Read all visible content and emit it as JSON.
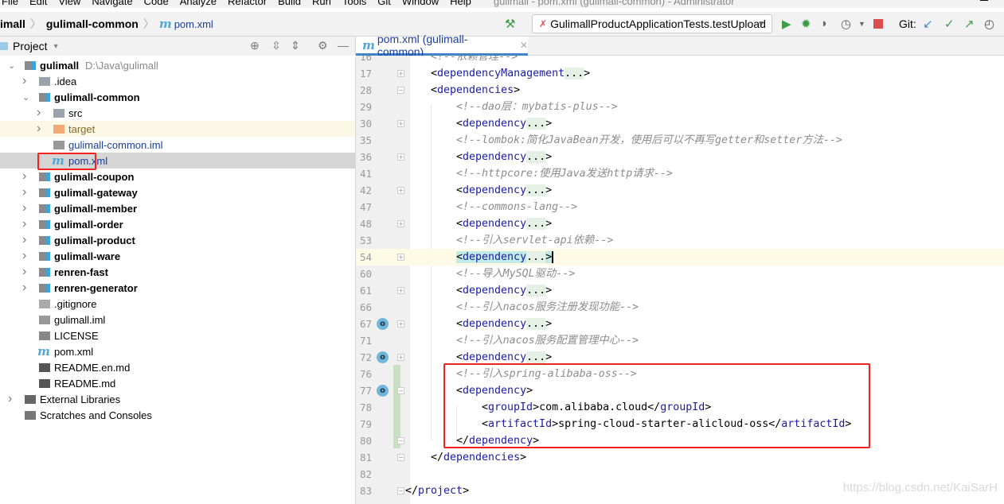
{
  "menu": {
    "items": [
      "File",
      "Edit",
      "View",
      "Navigate",
      "Code",
      "Analyze",
      "Refactor",
      "Build",
      "Run",
      "Tools",
      "Git",
      "Window",
      "Help"
    ],
    "window_title": "gulimall - pom.xml (gulimall-common) - Administrator"
  },
  "breadcrumb": {
    "items": [
      "imall",
      "gulimall-common"
    ],
    "file": "pom.xml",
    "file_icon": "maven-m-icon"
  },
  "toolbar": {
    "run_config": "GulimallProductApplicationTests.testUpload",
    "git_label": "Git:",
    "colors": {
      "run": "#3c9a46",
      "stop": "#db4c4f",
      "git_update": "#3d8fd8"
    }
  },
  "project_panel": {
    "title": "Project"
  },
  "tree": [
    {
      "level": 0,
      "label": "gulimall",
      "path": "D:\\Java\\gulimall",
      "bold": true,
      "arrow": "down",
      "icon": "module"
    },
    {
      "level": 1,
      "label": ".idea",
      "arrow": "right",
      "icon": "folder"
    },
    {
      "level": 1,
      "label": "gulimall-common",
      "bold": true,
      "arrow": "down",
      "icon": "module"
    },
    {
      "level": 2,
      "label": "src",
      "arrow": "right",
      "icon": "folder"
    },
    {
      "level": 2,
      "label": "target",
      "arrow": "right",
      "icon": "folder-orange",
      "highlight": "yellow"
    },
    {
      "level": 2,
      "label": "gulimall-common.iml",
      "icon": "iml",
      "blue": true
    },
    {
      "level": 2,
      "label": "pom.xml",
      "icon": "maven",
      "blue": true,
      "selected": true
    },
    {
      "level": 1,
      "label": "gulimall-coupon",
      "bold": true,
      "arrow": "right",
      "icon": "module"
    },
    {
      "level": 1,
      "label": "gulimall-gateway",
      "bold": true,
      "arrow": "right",
      "icon": "module"
    },
    {
      "level": 1,
      "label": "gulimall-member",
      "bold": true,
      "arrow": "right",
      "icon": "module"
    },
    {
      "level": 1,
      "label": "gulimall-order",
      "bold": true,
      "arrow": "right",
      "icon": "module"
    },
    {
      "level": 1,
      "label": "gulimall-product",
      "bold": true,
      "arrow": "right",
      "icon": "module"
    },
    {
      "level": 1,
      "label": "gulimall-ware",
      "bold": true,
      "arrow": "right",
      "icon": "module"
    },
    {
      "level": 1,
      "label": "renren-fast",
      "bold": true,
      "arrow": "right",
      "icon": "module"
    },
    {
      "level": 1,
      "label": "renren-generator",
      "bold": true,
      "arrow": "right",
      "icon": "module"
    },
    {
      "level": 1,
      "label": ".gitignore",
      "icon": "file"
    },
    {
      "level": 1,
      "label": "gulimall.iml",
      "icon": "iml"
    },
    {
      "level": 1,
      "label": "LICENSE",
      "icon": "text"
    },
    {
      "level": 1,
      "label": "pom.xml",
      "icon": "maven"
    },
    {
      "level": 1,
      "label": "README.en.md",
      "icon": "md"
    },
    {
      "level": 1,
      "label": "README.md",
      "icon": "md"
    },
    {
      "level": 0,
      "label": "External Libraries",
      "arrow": "right",
      "icon": "libs"
    },
    {
      "level": 0,
      "label": "Scratches and Consoles",
      "icon": "scratch"
    }
  ],
  "editor": {
    "tab": "pom.xml (gulimall-common)",
    "lines": [
      {
        "n": "16",
        "i": 1,
        "s": [
          [
            "cm",
            "<!--依赖管理-->"
          ]
        ]
      },
      {
        "n": "17",
        "i": 1,
        "f": "+",
        "s": [
          [
            "tag",
            "<"
          ],
          [
            "tn",
            "dependencyManagement"
          ],
          [
            "fold",
            "..."
          ],
          [
            "tag",
            ">"
          ]
        ]
      },
      {
        "n": "28",
        "i": 1,
        "f": "-",
        "s": [
          [
            "tag",
            "<"
          ],
          [
            "tn",
            "dependencies"
          ],
          [
            "tag",
            ">"
          ]
        ]
      },
      {
        "n": "29",
        "i": 2,
        "s": [
          [
            "cm",
            "<!--dao层：mybatis-plus-->"
          ]
        ]
      },
      {
        "n": "30",
        "i": 2,
        "f": "+",
        "s": [
          [
            "tag",
            "<"
          ],
          [
            "tn",
            "dependency"
          ],
          [
            "fold",
            "..."
          ],
          [
            "tag",
            ">"
          ]
        ]
      },
      {
        "n": "35",
        "i": 2,
        "s": [
          [
            "cm",
            "<!--lombok:简化JavaBean开发，使用后可以不再写getter和setter方法-->"
          ]
        ]
      },
      {
        "n": "36",
        "i": 2,
        "f": "+",
        "s": [
          [
            "tag",
            "<"
          ],
          [
            "tn",
            "dependency"
          ],
          [
            "fold",
            "..."
          ],
          [
            "tag",
            ">"
          ]
        ]
      },
      {
        "n": "41",
        "i": 2,
        "s": [
          [
            "cm",
            "<!--httpcore:使用Java发送http请求-->"
          ]
        ]
      },
      {
        "n": "42",
        "i": 2,
        "f": "+",
        "s": [
          [
            "tag",
            "<"
          ],
          [
            "tn",
            "dependency"
          ],
          [
            "fold",
            "..."
          ],
          [
            "tag",
            ">"
          ]
        ]
      },
      {
        "n": "47",
        "i": 2,
        "s": [
          [
            "cm",
            "<!--commons-lang-->"
          ]
        ]
      },
      {
        "n": "48",
        "i": 2,
        "f": "+",
        "s": [
          [
            "tag",
            "<"
          ],
          [
            "tn",
            "dependency"
          ],
          [
            "fold",
            "..."
          ],
          [
            "tag",
            ">"
          ]
        ]
      },
      {
        "n": "53",
        "i": 2,
        "s": [
          [
            "cm",
            "<!--引入servlet-api依赖-->"
          ]
        ]
      },
      {
        "n": "54",
        "i": 2,
        "f": "+",
        "cur": true,
        "s": [
          [
            "hl",
            "<"
          ],
          [
            "tn hl",
            "dependency"
          ],
          [
            "fold",
            "..."
          ],
          [
            "hl",
            ">"
          ]
        ]
      },
      {
        "n": "60",
        "i": 2,
        "s": [
          [
            "cm",
            "<!--导入MySQL驱动-->"
          ]
        ]
      },
      {
        "n": "61",
        "i": 2,
        "f": "+",
        "s": [
          [
            "tag",
            "<"
          ],
          [
            "tn",
            "dependency"
          ],
          [
            "fold",
            "..."
          ],
          [
            "tag",
            ">"
          ]
        ]
      },
      {
        "n": "66",
        "i": 2,
        "s": [
          [
            "cm",
            "<!--引入nacos服务注册发现功能-->"
          ]
        ]
      },
      {
        "n": "67",
        "i": 2,
        "f": "+",
        "o": true,
        "s": [
          [
            "tag",
            "<"
          ],
          [
            "tn",
            "dependency"
          ],
          [
            "fold",
            "..."
          ],
          [
            "tag",
            ">"
          ]
        ]
      },
      {
        "n": "71",
        "i": 2,
        "s": [
          [
            "cm",
            "<!--引入nacos服务配置管理中心-->"
          ]
        ]
      },
      {
        "n": "72",
        "i": 2,
        "f": "+",
        "o": true,
        "s": [
          [
            "tag",
            "<"
          ],
          [
            "tn",
            "dependency"
          ],
          [
            "fold",
            "..."
          ],
          [
            "tag",
            ">"
          ]
        ]
      },
      {
        "n": "76",
        "i": 2,
        "c": true,
        "s": [
          [
            "cm",
            "<!--引入spring-alibaba-oss-->"
          ]
        ]
      },
      {
        "n": "77",
        "i": 2,
        "f": "-",
        "o": true,
        "c": true,
        "s": [
          [
            "tag",
            "<"
          ],
          [
            "tn",
            "dependency"
          ],
          [
            "tag",
            ">"
          ]
        ]
      },
      {
        "n": "78",
        "i": 3,
        "c": true,
        "s": [
          [
            "tag",
            "<"
          ],
          [
            "tn",
            "groupId"
          ],
          [
            "tag",
            ">"
          ],
          [
            "txt",
            "com.alibaba.cloud"
          ],
          [
            "tag",
            "</"
          ],
          [
            "tn",
            "groupId"
          ],
          [
            "tag",
            ">"
          ]
        ]
      },
      {
        "n": "79",
        "i": 3,
        "c": true,
        "s": [
          [
            "tag",
            "<"
          ],
          [
            "tn",
            "artifactId"
          ],
          [
            "tag",
            ">"
          ],
          [
            "txt",
            "spring-cloud-starter-alicloud-oss"
          ],
          [
            "tag",
            "</"
          ],
          [
            "tn",
            "artifactId"
          ],
          [
            "tag",
            ">"
          ]
        ]
      },
      {
        "n": "80",
        "i": 2,
        "f": "-",
        "c": true,
        "s": [
          [
            "tag",
            "</"
          ],
          [
            "tn",
            "dependency"
          ],
          [
            "tag",
            ">"
          ]
        ]
      },
      {
        "n": "81",
        "i": 1,
        "f": "-",
        "s": [
          [
            "tag",
            "</"
          ],
          [
            "tn",
            "dependencies"
          ],
          [
            "tag",
            ">"
          ]
        ]
      },
      {
        "n": "82",
        "i": 0,
        "s": []
      },
      {
        "n": "83",
        "i": 0,
        "f": "-",
        "s": [
          [
            "tag",
            "</"
          ],
          [
            "tn",
            "project"
          ],
          [
            "tag",
            ">"
          ]
        ]
      }
    ]
  },
  "watermark": "https://blog.csdn.net/KaiSarH",
  "colors": {
    "highlight_box": "#f2231a",
    "tag_name": "#1a1aa6",
    "comment": "#8c8c8c"
  }
}
